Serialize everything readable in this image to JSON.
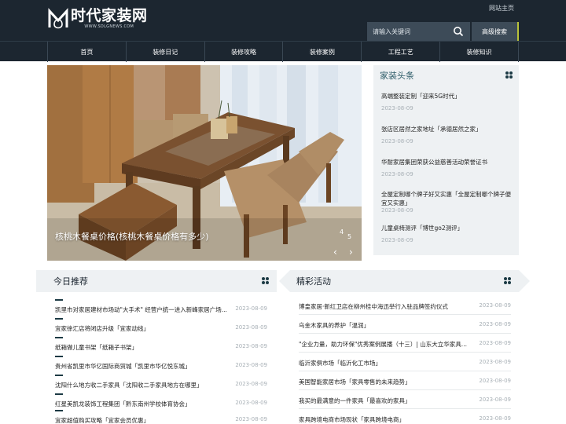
{
  "header": {
    "logo_cn": "时代家装网",
    "logo_url": "WWW.SDLGNEWS.COM",
    "home_link": "网站主页",
    "search_placeholder": "请输入关键词",
    "advanced_search": "高级搜索"
  },
  "nav": {
    "items": [
      "首页",
      "装修日记",
      "装修攻略",
      "装修案例",
      "工程工艺",
      "装修知识"
    ]
  },
  "banner": {
    "caption": "核桃木餐桌价格(核桃木餐桌价格有多少)",
    "slide_index": "4",
    "slide_total": "5",
    "prev_icon": "chevron-left-icon",
    "next_icon": "chevron-right-icon"
  },
  "headlines": {
    "title": "家装头条",
    "items": [
      {
        "title": "高端整装定制「迎来5G时代」",
        "date": "2023-08-09"
      },
      {
        "title": "张店区居然之家地址「承德居然之家」",
        "date": "2023-08-09"
      },
      {
        "title": "华耐家居集团荣获公益慈善活动荣誉证书",
        "date": "2023-08-09"
      },
      {
        "title": "全屋定制哪个牌子好又实惠「全屋定制哪个牌子便宜又实惠」",
        "date": "2023-08-09"
      },
      {
        "title": "儿童桌椅测评「博世go2测评」",
        "date": "2023-08-09"
      }
    ]
  },
  "today": {
    "title": "今日推荐",
    "items": [
      {
        "title": "凯里市对家居建材市场动\"大手术\" 经营户统一进入新峰家居广场...",
        "date": "2023-08-09"
      },
      {
        "title": "宜家徐汇店将闭店升级「宜家动线」",
        "date": "2023-08-09"
      },
      {
        "title": "纸箱做儿童书架「纸箱子书架」",
        "date": "2023-08-09"
      },
      {
        "title": "贵州省凯里市华亿国际商贸城「凯里市华亿悦东城」",
        "date": "2023-08-09"
      },
      {
        "title": "沈阳什么地方收二手家具「沈阳收二手家具地方在哪里」",
        "date": "2023-08-09"
      },
      {
        "title": "红星美凯龙装饰工程集团「黔东南州学校体育协会」",
        "date": "2023-08-09"
      },
      {
        "title": "宜家超值购买攻略「宜家会员优惠」",
        "date": "2023-08-09"
      }
    ]
  },
  "activities": {
    "title": "精彩活动",
    "items": [
      {
        "title": "博皇家居·新红卫店在柳州桂中海迅举行入驻品牌签约仪式",
        "date": "2023-08-09"
      },
      {
        "title": "乌金木家具的养护「温润」",
        "date": "2023-08-09"
      },
      {
        "title": "\"企业力量，助力环保\"优秀案例展播（十三）| 山东大立华家具...",
        "date": "2023-08-09"
      },
      {
        "title": "临沂家俱市场「临沂化工市场」",
        "date": "2023-08-09"
      },
      {
        "title": "美国智能家居市场「家具零售的未来趋势」",
        "date": "2023-08-09"
      },
      {
        "title": "我买的最满意的一件家具「最喜欢的家具」",
        "date": "2023-08-09"
      },
      {
        "title": "家具跨境电商市场现状「家具跨境电商」",
        "date": "2023-08-09"
      }
    ]
  },
  "colors": {
    "header_bg": "#1c2630",
    "search_bg": "#3d4b58",
    "accent": "#b8c23a",
    "box_bg": "#eef1f3",
    "title_teal": "#2d5c68"
  }
}
